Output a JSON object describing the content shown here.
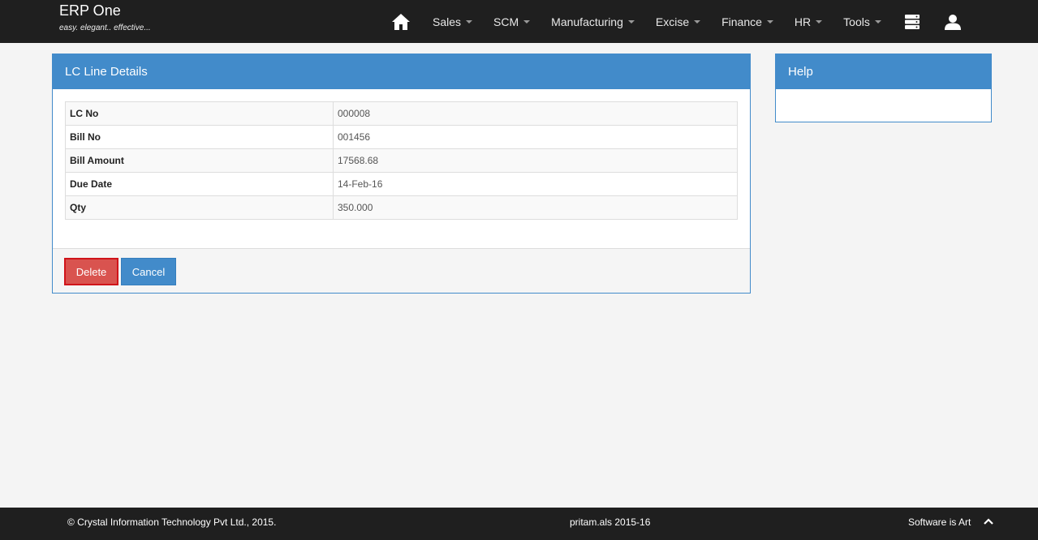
{
  "header": {
    "brand_title": "ERP One",
    "brand_tagline": "easy. elegant.. effective...",
    "home_icon": "home-icon",
    "menu": [
      {
        "label": "Sales"
      },
      {
        "label": "SCM"
      },
      {
        "label": "Manufacturing"
      },
      {
        "label": "Excise"
      },
      {
        "label": "Finance"
      },
      {
        "label": "HR"
      },
      {
        "label": "Tools"
      }
    ],
    "server_icon": "server-icon",
    "user_icon": "user-icon"
  },
  "panel": {
    "title": "LC Line Details",
    "rows": [
      {
        "label": "LC No",
        "value": "000008"
      },
      {
        "label": "Bill No",
        "value": "001456"
      },
      {
        "label": "Bill Amount",
        "value": "17568.68"
      },
      {
        "label": "Due Date",
        "value": "14-Feb-16"
      },
      {
        "label": "Qty",
        "value": "350.000"
      }
    ],
    "delete_label": "Delete",
    "cancel_label": "Cancel"
  },
  "help": {
    "title": "Help"
  },
  "footer": {
    "copyright": "© Crystal Information Technology Pvt Ltd., 2015.",
    "session": "pritam.als 2015-16",
    "slogan": "Software is Art",
    "scroll_icon": "chevron-up-icon"
  },
  "colors": {
    "navbar": "#1f1f1f",
    "primary": "#428bca",
    "danger": "#d9534f",
    "background": "#f4f4f4"
  }
}
